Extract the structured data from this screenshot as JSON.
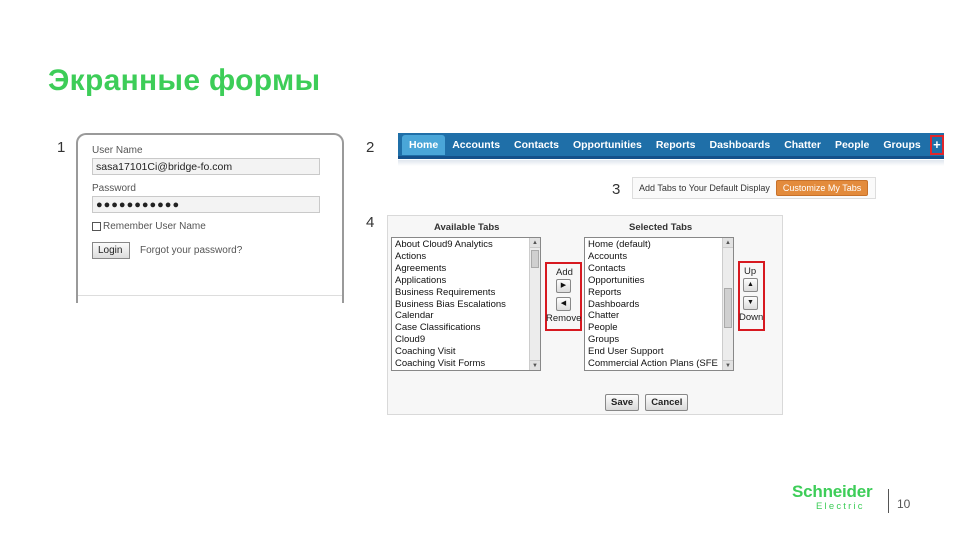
{
  "slide": {
    "title": "Экранные формы",
    "page_number": "10",
    "markers": [
      "1",
      "2",
      "3",
      "4"
    ]
  },
  "login": {
    "user_label": "User Name",
    "user_value": "sasa17101Ci@bridge-fo.com",
    "password_label": "Password",
    "password_value": "●●●●●●●●●●●",
    "remember_label": "Remember User Name",
    "login_button": "Login",
    "forgot_link": "Forgot your password?"
  },
  "tabbar": {
    "tabs": [
      "Home",
      "Accounts",
      "Contacts",
      "Opportunities",
      "Reports",
      "Dashboards",
      "Chatter",
      "People",
      "Groups"
    ],
    "active": "Home",
    "plus_label": "+"
  },
  "customize": {
    "text": "Add Tabs to Your Default Display",
    "button": "Customize My Tabs"
  },
  "selector": {
    "available_heading": "Available Tabs",
    "selected_heading": "Selected Tabs",
    "available_items": [
      "About Cloud9 Analytics",
      "Actions",
      "Agreements",
      "Applications",
      "Business Requirements",
      "Business Bias Escalations",
      "Calendar",
      "Case Classifications",
      "Cloud9",
      "Coaching Visit",
      "Coaching Visit Forms"
    ],
    "selected_items": [
      "Home (default)",
      "Accounts",
      "Contacts",
      "Opportunities",
      "Reports",
      "Dashboards",
      "Chatter",
      "People",
      "Groups",
      "End User Support",
      "Commercial Action Plans (SFE"
    ],
    "add_label": "Add",
    "remove_label": "Remove",
    "up_label": "Up",
    "down_label": "Down",
    "add_icon": "▶",
    "remove_icon": "◀",
    "up_icon": "▲",
    "down_icon": "▼",
    "save_button": "Save",
    "cancel_button": "Cancel"
  },
  "logo": {
    "name": "Schneider",
    "sub": "Electric"
  },
  "colors": {
    "title_green": "#3dcd58",
    "tabbar_blue": "#1f6fa8",
    "highlight_red": "#d71920",
    "customize_orange": "#e38b3c"
  }
}
